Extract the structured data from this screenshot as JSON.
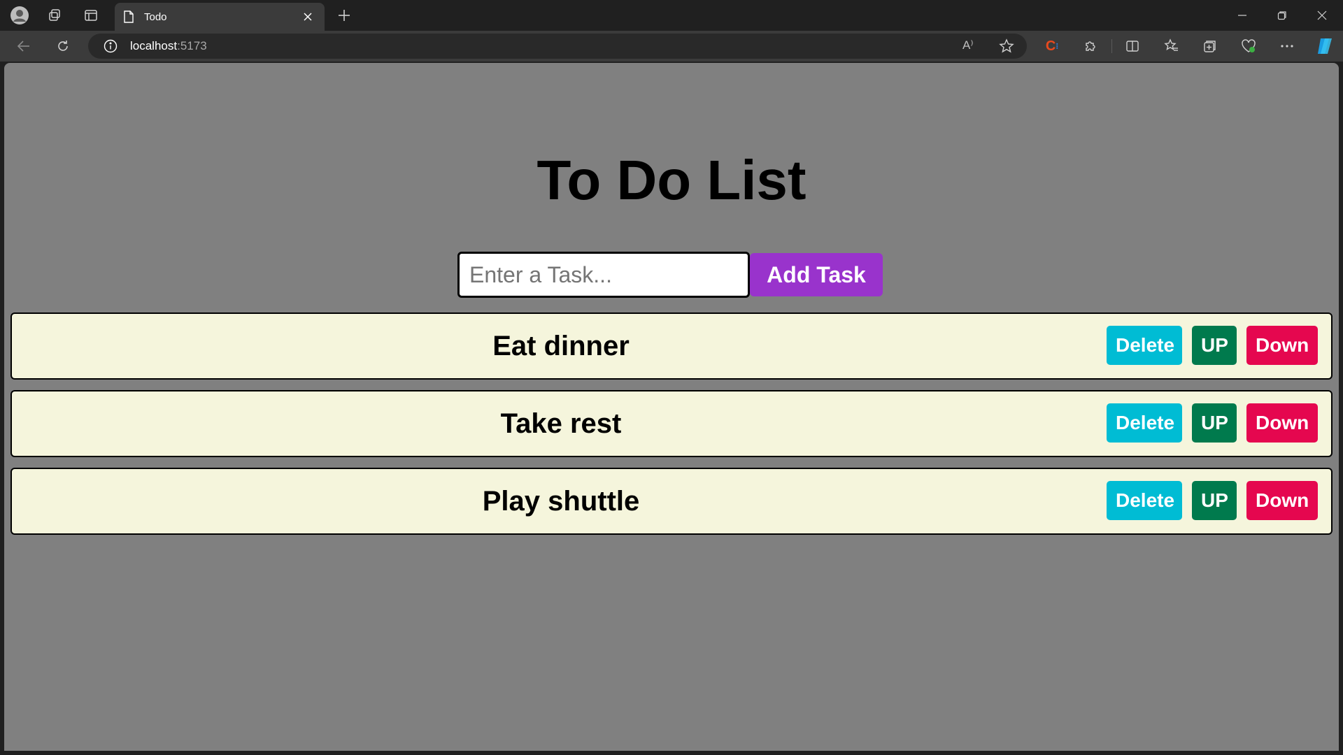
{
  "browser": {
    "tab": {
      "title": "Todo"
    },
    "address": {
      "host": "localhost",
      "port": ":5173"
    },
    "read_aloud_label": "A⁾"
  },
  "app": {
    "title": "To Do List",
    "input": {
      "placeholder": "Enter a Task...",
      "value": ""
    },
    "add_button_label": "Add Task",
    "tasks": [
      {
        "text": "Eat dinner"
      },
      {
        "text": "Take rest"
      },
      {
        "text": "Play shuttle"
      }
    ],
    "buttons": {
      "delete": "Delete",
      "up": "UP",
      "down": "Down"
    }
  },
  "colors": {
    "page_bg": "#808080",
    "task_bg": "#f5f5dc",
    "add_button": "#9933cc",
    "delete_button": "#00bcd4",
    "up_button": "#007a4d",
    "down_button": "#e5074f"
  }
}
